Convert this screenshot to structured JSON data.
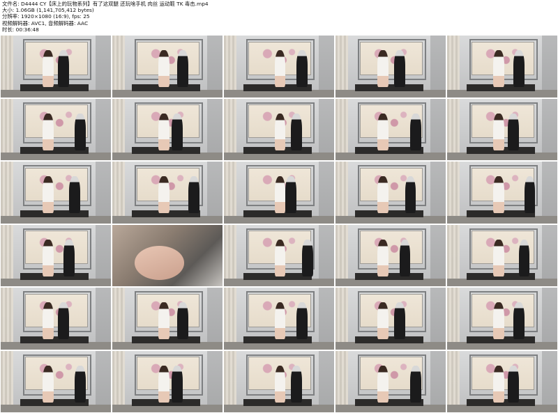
{
  "header": {
    "line1": "文件名: D4444 CY【床上的玩物系列】有了这双腿 还玩啥手机 肉丝 运动鞋 TK 毒击.mp4",
    "line2": "大小: 1.06GB (1,141,705,412 bytes)",
    "line3": "分辨率: 1920×1080 (16:9), fps: 25",
    "line4": "视频解码器: AVC1, 音频解码器: AAC",
    "line5": "时长: 00:36:48"
  },
  "thumbnails": [
    {
      "variant": "stage"
    },
    {
      "variant": "stage"
    },
    {
      "variant": "stage"
    },
    {
      "variant": "stage"
    },
    {
      "variant": "stage"
    },
    {
      "variant": "stage"
    },
    {
      "variant": "stage"
    },
    {
      "variant": "stage"
    },
    {
      "variant": "stage"
    },
    {
      "variant": "stage"
    },
    {
      "variant": "stage"
    },
    {
      "variant": "stage"
    },
    {
      "variant": "stage"
    },
    {
      "variant": "stage"
    },
    {
      "variant": "stage"
    },
    {
      "variant": "stage"
    },
    {
      "variant": "closeup"
    },
    {
      "variant": "stage"
    },
    {
      "variant": "stage"
    },
    {
      "variant": "stage"
    },
    {
      "variant": "stage"
    },
    {
      "variant": "stage"
    },
    {
      "variant": "stage"
    },
    {
      "variant": "stage"
    },
    {
      "variant": "stage"
    },
    {
      "variant": "stage"
    },
    {
      "variant": "stage"
    },
    {
      "variant": "stage"
    },
    {
      "variant": "stage"
    },
    {
      "variant": "stage"
    }
  ]
}
